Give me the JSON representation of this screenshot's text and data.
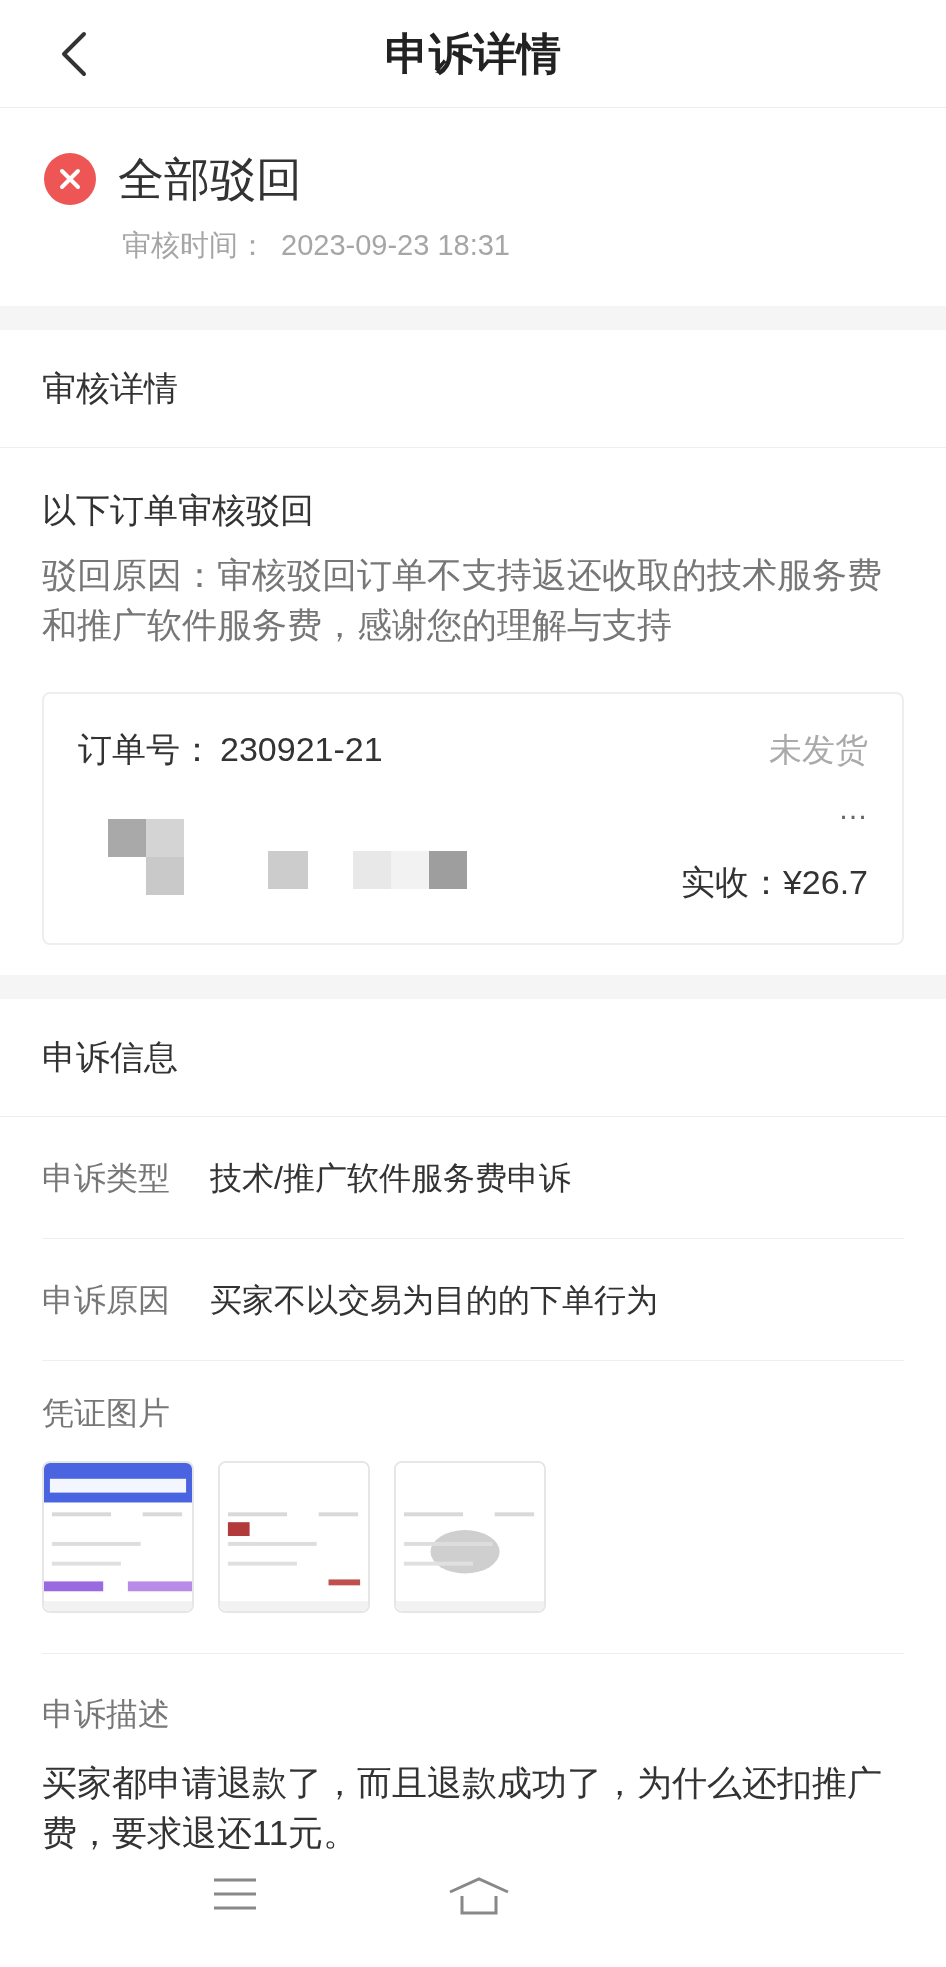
{
  "header": {
    "title": "申诉详情"
  },
  "status": {
    "title": "全部驳回",
    "time_label": "审核时间：",
    "time": "2023-09-23 18:31"
  },
  "review": {
    "heading": "审核详情",
    "subheading": "以下订单审核驳回",
    "reason": "驳回原因：审核驳回订单不支持返还收取的技术服务费和推广软件服务费，感谢您的理解与支持",
    "order": {
      "number_label": "订单号：",
      "number": "230921-21",
      "status": "未发货",
      "more": "…",
      "received_label": "实收：",
      "received": "¥26.7"
    }
  },
  "appeal": {
    "heading": "申诉信息",
    "fields": [
      {
        "label": "申诉类型",
        "value": "技术/推广软件服务费申诉"
      },
      {
        "label": "申诉原因",
        "value": "买家不以交易为目的的下单行为"
      }
    ],
    "images_label": "凭证图片",
    "description_label": "申诉描述",
    "description": "买家都申请退款了，而且退款成功了，为什么还扣推广费，要求退还11元。"
  }
}
